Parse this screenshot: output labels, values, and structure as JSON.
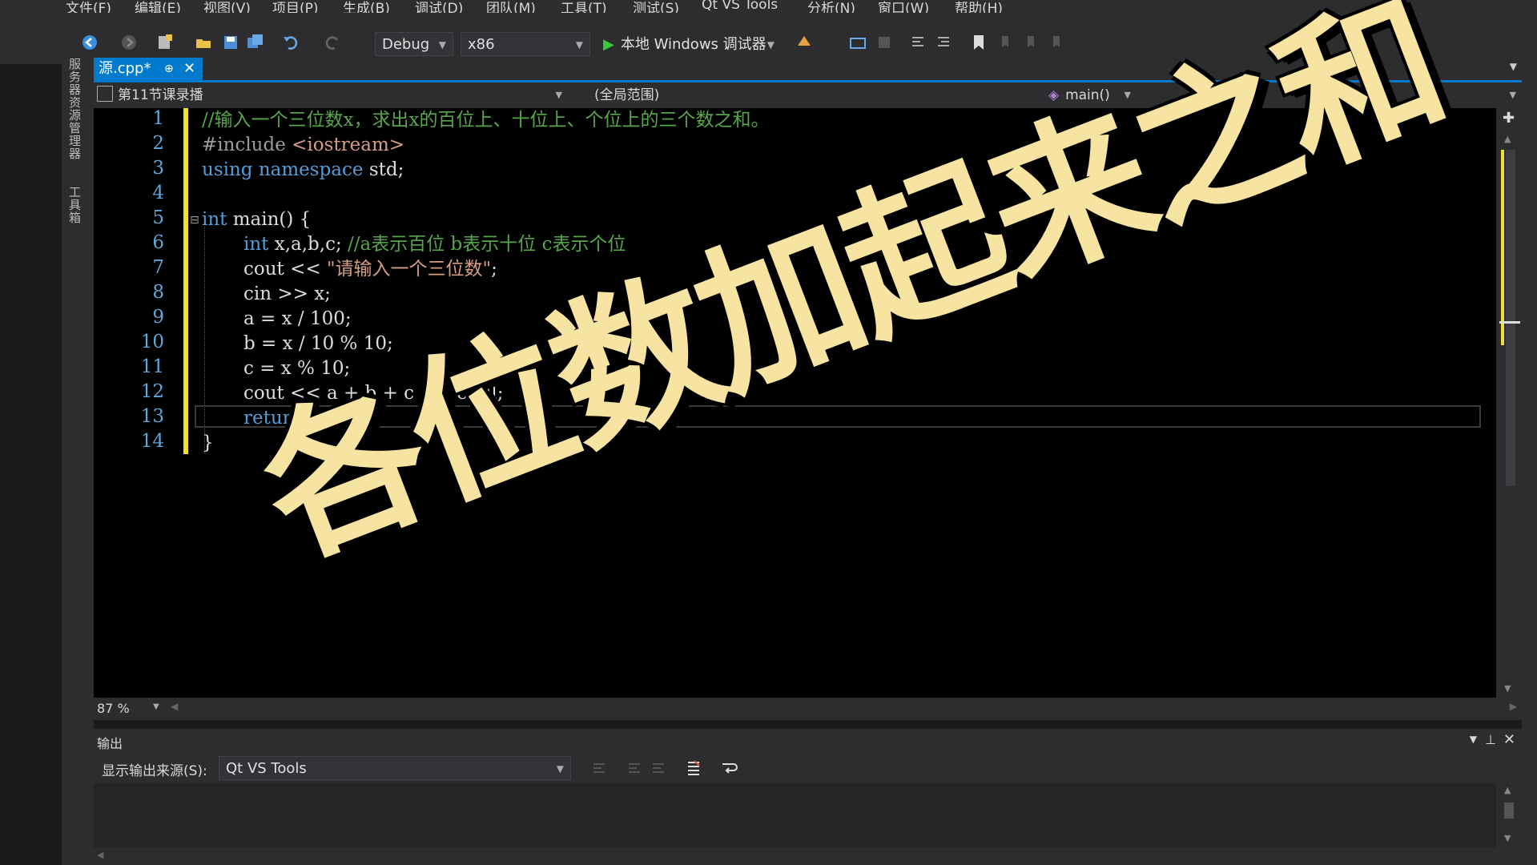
{
  "menu": [
    "文件(F)",
    "编辑(E)",
    "视图(V)",
    "项目(P)",
    "生成(B)",
    "调试(D)",
    "团队(M)",
    "工具(T)",
    "测试(S)",
    "Qt VS Tools",
    "分析(N)",
    "窗口(W)",
    "帮助(H)"
  ],
  "toolbar": {
    "config": "Debug",
    "platform": "x86",
    "run_label": "本地 Windows 调试器"
  },
  "side_tabs": [
    "服务器资源管理器",
    "工具箱"
  ],
  "editor": {
    "tab_title": "源.cpp*",
    "nav_project": "第11节课录播",
    "nav_scope": "(全局范围)",
    "nav_function": "main()",
    "zoom": "87 %",
    "line_numbers": [
      "1",
      "2",
      "3",
      "4",
      "5",
      "6",
      "7",
      "8",
      "9",
      "10",
      "11",
      "12",
      "13",
      "14"
    ],
    "code": {
      "l1": "//输入一个三位数x，求出x的百位上、十位上、个位上的三个数之和。",
      "l2_pp": "#include ",
      "l2_hdr": "<iostream>",
      "l3_kw1": "using",
      "l3_kw2": "namespace",
      "l3_rest": " std;",
      "l5_kw": "int",
      "l5_rest": " main() {",
      "l6_kw": "int",
      "l6_rest": " x,a,b,c; ",
      "l6_cm": "//a表示百位 b表示十位 c表示个位",
      "l7_a": "cout << ",
      "l7_str": "\"请输入一个三位数\"",
      "l7_b": ";",
      "l8": "cin >> x;",
      "l9": "a = x / 100;",
      "l10": "b = x / 10 % 10;",
      "l11": "c = x % 10;",
      "l12": "cout << a + b + c << endl;",
      "l13_kw": "return",
      "l13_rest": " 0;",
      "l14": "}"
    }
  },
  "output": {
    "title": "输出",
    "source_label": "显示输出来源(S):",
    "source_value": "Qt VS Tools"
  },
  "overlay": {
    "caption": "各位数加起来之和"
  },
  "colors": {
    "accent": "#007acc",
    "caption": "#f7e3a2",
    "comment": "#57a64a",
    "keyword": "#569cd6",
    "string": "#d69d85",
    "change_bar": "#f0e030"
  }
}
